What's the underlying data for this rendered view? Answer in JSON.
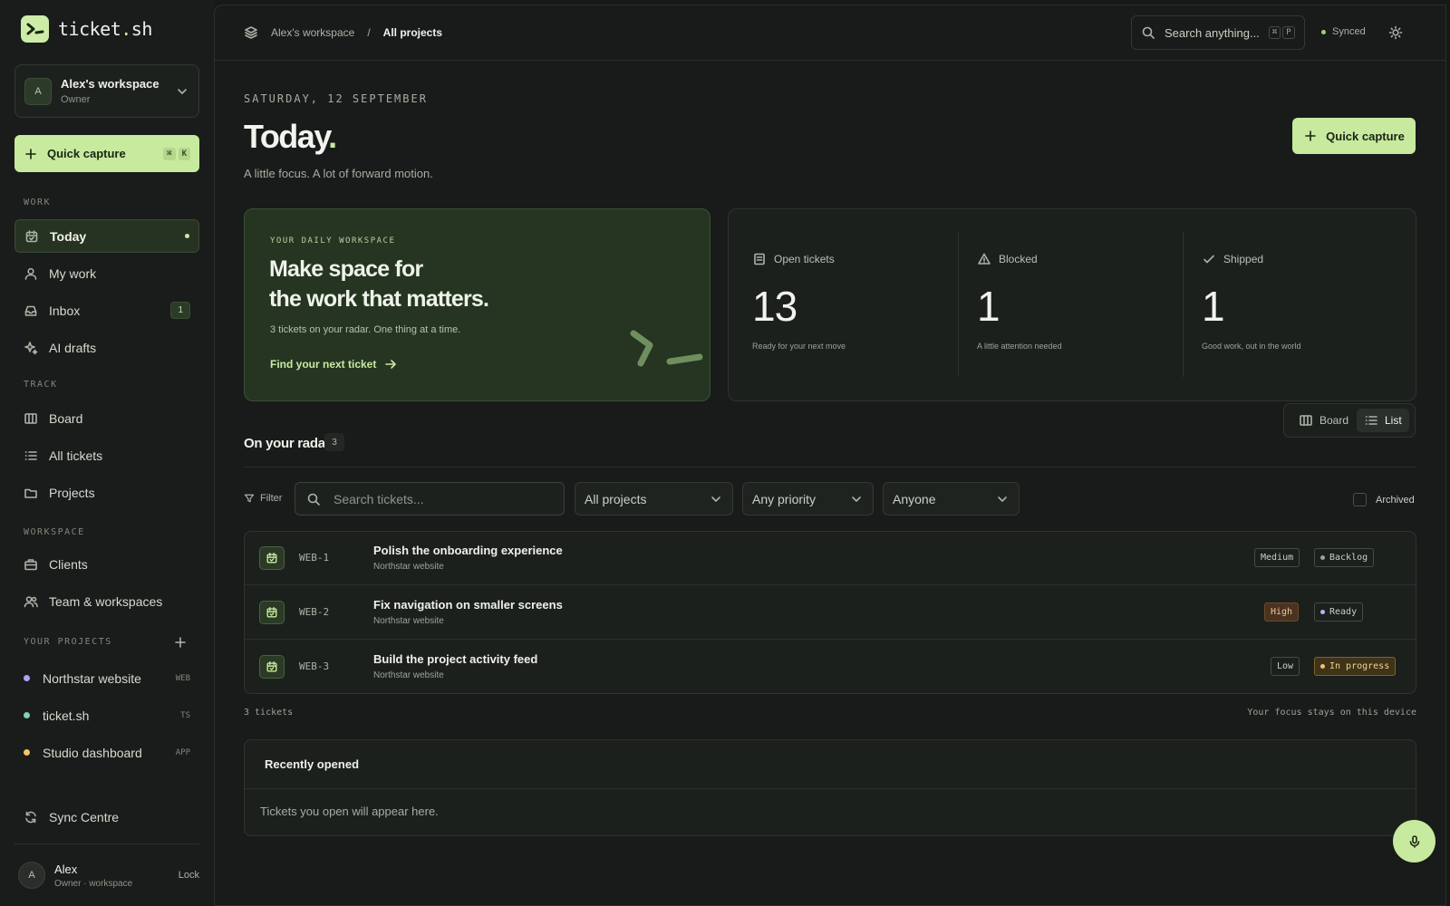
{
  "brand": {
    "name_main": "ticket",
    "name_dot": ".",
    "name_tld": "sh"
  },
  "workspace": {
    "avatar": "A",
    "name": "Alex's workspace",
    "role": "Owner"
  },
  "sidebar": {
    "quick_capture": {
      "label": "Quick capture",
      "keys": [
        "⌘",
        "K"
      ]
    },
    "sections": {
      "work": "WORK",
      "track": "TRACK",
      "workspace": "WORKSPACE",
      "projects": "YOUR PROJECTS"
    },
    "work_items": [
      {
        "label": "Today",
        "icon": "calendar-icon",
        "active": true
      },
      {
        "label": "My work",
        "icon": "user-icon"
      },
      {
        "label": "Inbox",
        "icon": "inbox-icon",
        "badge": "1"
      },
      {
        "label": "AI drafts",
        "icon": "sparkle-icon"
      }
    ],
    "track_items": [
      {
        "label": "Board",
        "icon": "board-icon"
      },
      {
        "label": "All tickets",
        "icon": "list-icon"
      },
      {
        "label": "Projects",
        "icon": "folder-icon"
      }
    ],
    "workspace_items": [
      {
        "label": "Clients",
        "icon": "briefcase-icon"
      },
      {
        "label": "Team & workspaces",
        "icon": "users-icon"
      }
    ],
    "projects": [
      {
        "label": "Northstar website",
        "code": "WEB",
        "color": "#a9a7f2"
      },
      {
        "label": "ticket.sh",
        "code": "TS",
        "color": "#7fd3b4"
      },
      {
        "label": "Studio dashboard",
        "code": "APP",
        "color": "#f2c46a"
      }
    ],
    "sync": "Sync Centre",
    "user": {
      "avatar": "A",
      "name": "Alex",
      "role": "Owner · workspace",
      "lock": "Lock"
    }
  },
  "topbar": {
    "breadcrumb": [
      "Alex's workspace",
      "/",
      "All projects"
    ],
    "search_placeholder": "Search anything...",
    "search_keys": [
      "⌘",
      "P"
    ],
    "status": "Synced"
  },
  "page": {
    "date": "SATURDAY, 12 SEPTEMBER",
    "title": "Today",
    "title_dot": ".",
    "subtitle": "A little focus. A lot of forward motion.",
    "quick_capture": "Quick capture"
  },
  "hero": {
    "eyebrow": "YOUR DAILY WORKSPACE",
    "heading_line1": "Make space for",
    "heading_line2": "the work that matters.",
    "text": "3 tickets on your radar. One thing at a time.",
    "link": "Find your next ticket"
  },
  "stats": [
    {
      "label": "Open tickets",
      "value": "13",
      "note": "Ready for your next move",
      "icon": "ticket-icon"
    },
    {
      "label": "Blocked",
      "value": "1",
      "note": "A little attention needed",
      "icon": "warning-icon"
    },
    {
      "label": "Shipped",
      "value": "1",
      "note": "Good work, out in the world",
      "icon": "check-icon"
    }
  ],
  "radar": {
    "heading": "On your radar",
    "count": "3",
    "view_board": "Board",
    "view_list": "List",
    "active_view": "List"
  },
  "filters": {
    "label": "Filter",
    "search_placeholder": "Search tickets...",
    "project": "All projects",
    "priority": "Any priority",
    "assignee": "Anyone",
    "archived": "Archived"
  },
  "tickets": [
    {
      "id": "WEB-1",
      "title": "Polish the onboarding experience",
      "project": "Northstar website",
      "priority": "Medium",
      "status": "Backlog",
      "status_color": "#9aa397"
    },
    {
      "id": "WEB-2",
      "title": "Fix navigation on smaller screens",
      "project": "Northstar website",
      "priority": "High",
      "status": "Ready",
      "status_color": "#a9b8f2"
    },
    {
      "id": "WEB-3",
      "title": "Build the project activity feed",
      "project": "Northstar website",
      "priority": "Low",
      "status": "In progress",
      "status_color": "#f2c46a"
    }
  ],
  "list_footer": {
    "count": "3 tickets",
    "note": "Your focus stays on this device"
  },
  "recent": {
    "heading": "Recently opened",
    "empty": "Tickets you open will appear here."
  },
  "colors": {
    "accent": "#c7ea9f",
    "background": "#161917",
    "hero": "#263422"
  }
}
